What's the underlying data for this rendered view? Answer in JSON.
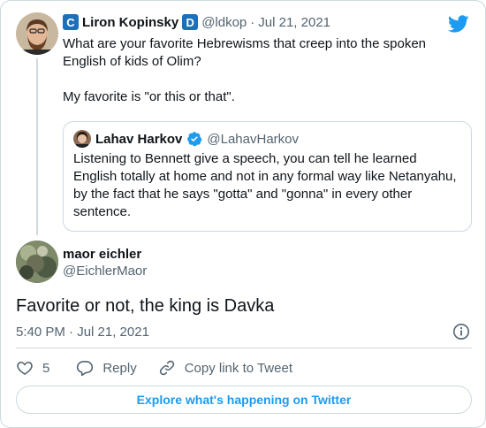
{
  "parent_tweet": {
    "name": "Liron Kopinsky",
    "handle": "@ldkop",
    "separator": "·",
    "date": "Jul 21, 2021",
    "text": "What are your favorite Hebrewisms that creep into the spoken English of kids of Olim?\n\nMy favorite is \"or this or that\"."
  },
  "quoted_tweet": {
    "name": "Lahav Harkov",
    "handle": "@LahavHarkov",
    "text": "Listening to Bennett give a speech, you can tell he learned English totally at home and not in any formal way like Netanyahu, by the fact that he says \"gotta\" and \"gonna\" in every other sentence."
  },
  "main_tweet": {
    "name": "maor eichler",
    "handle": "@EichlerMaor",
    "text": "Favorite or not, the king is Davka",
    "timestamp": "5:40 PM · Jul 21, 2021"
  },
  "actions": {
    "like_count": "5",
    "reply_label": "Reply",
    "copy_label": "Copy link to Tweet"
  },
  "explore_label": "Explore what's happening on Twitter",
  "colors": {
    "accent": "#1d9bf0",
    "muted": "#536471",
    "border": "#cfd9de",
    "text": "#0f1419"
  },
  "icons": [
    "twitter-bird-icon",
    "verified-icon",
    "info-icon",
    "heart-icon",
    "reply-icon",
    "link-icon"
  ]
}
